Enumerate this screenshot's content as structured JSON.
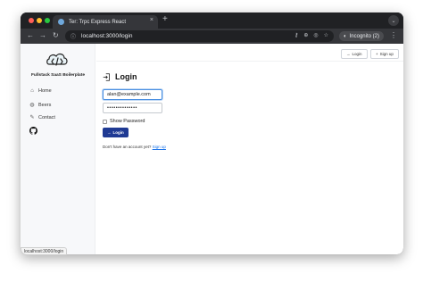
{
  "browser": {
    "tab_title": "Ter: Trpc Express React",
    "tab_close": "×",
    "new_tab": "+",
    "tab_menu": "⌄",
    "url": "localhost:3000/login",
    "incognito_label": "Incognito (2)",
    "status_url": "localhost:3000/login"
  },
  "sidebar": {
    "brand": "Fullstack SaaS Boilerplate",
    "items": [
      {
        "label": "Home",
        "icon": "home-icon"
      },
      {
        "label": "Beers",
        "icon": "beer-icon"
      },
      {
        "label": "Contact",
        "icon": "pencil-icon"
      }
    ]
  },
  "topbar": {
    "login_label": "Login",
    "signup_label": "Sign up"
  },
  "form": {
    "title": "Login",
    "email_value": "alan@example.com",
    "password_value": "••••••••••••••",
    "remember_label": "Show Password",
    "submit_label": "Login",
    "signup_prompt": "Don't have an account yet?",
    "signup_link": "Sign up"
  },
  "colors": {
    "primary": "#1f3a93",
    "link": "#1a73e8",
    "chrome_dark": "#202124"
  }
}
